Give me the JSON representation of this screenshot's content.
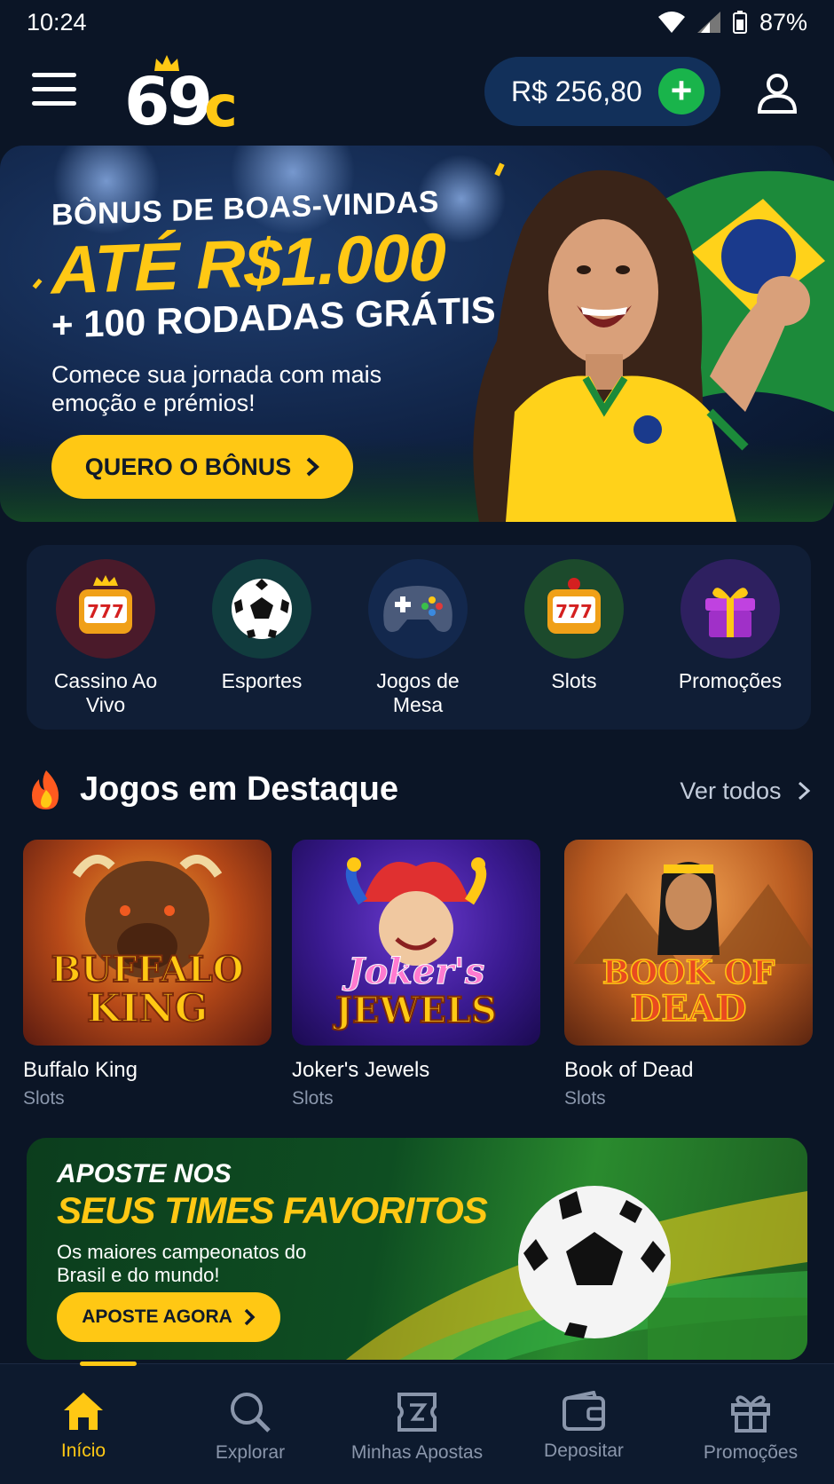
{
  "status_bar": {
    "time": "10:24",
    "battery": "87%"
  },
  "header": {
    "logo_number": "69",
    "logo_letter": "c",
    "balance": "R$ 256,80",
    "deposit_symbol": "+"
  },
  "hero": {
    "pretitle": "BÔNUS DE BOAS-VINDAS",
    "title": "ATÉ R$1.000",
    "subtitle": "+ 100 RODADAS GRÁTIS",
    "description": "Comece sua jornada com mais emoção e prémios!",
    "cta_label": "QUERO O BÔNUS"
  },
  "categories": [
    {
      "label": "Cassino Ao Vivo",
      "icon": "slot-machine-crown-icon",
      "bg": "#4a1a2a"
    },
    {
      "label": "Esportes",
      "icon": "soccer-ball-icon",
      "bg": "#113c3e"
    },
    {
      "label": "Jogos de Mesa",
      "icon": "gamepad-icon",
      "bg": "#13284d"
    },
    {
      "label": "Slots",
      "icon": "slot-machine-icon",
      "bg": "#1c4a2c"
    },
    {
      "label": "Promoções",
      "icon": "gift-icon",
      "bg": "#2e2060"
    }
  ],
  "featured": {
    "title": "Jogos em Destaque",
    "see_all": "Ver todos",
    "games": [
      {
        "name": "Buffalo King",
        "category": "Slots",
        "thumb_text_1": "BUFFALO",
        "thumb_text_2": "KING"
      },
      {
        "name": "Joker's Jewels",
        "category": "Slots",
        "thumb_text_1": "Joker's",
        "thumb_text_2": "JEWELS"
      },
      {
        "name": "Book of Dead",
        "category": "Slots",
        "thumb_text_1": "BOOK OF",
        "thumb_text_2": "DEAD"
      }
    ]
  },
  "sports_banner": {
    "pretitle": "APOSTE NOS",
    "title": "SEUS TIMES FAVORITOS",
    "description": "Os maiores campeonatos do Brasil e do mundo!",
    "cta_label": "APOSTE AGORA"
  },
  "bottom_nav": [
    {
      "label": "Início",
      "icon": "home-icon",
      "active": true
    },
    {
      "label": "Explorar",
      "icon": "search-icon",
      "active": false
    },
    {
      "label": "Minhas Apostas",
      "icon": "ticket-icon",
      "active": false
    },
    {
      "label": "Depositar",
      "icon": "wallet-icon",
      "active": false
    },
    {
      "label": "Promoções",
      "icon": "gift-icon",
      "active": false
    }
  ],
  "colors": {
    "accent": "#ffc814",
    "background": "#0b1526",
    "green": "#19b44b"
  }
}
